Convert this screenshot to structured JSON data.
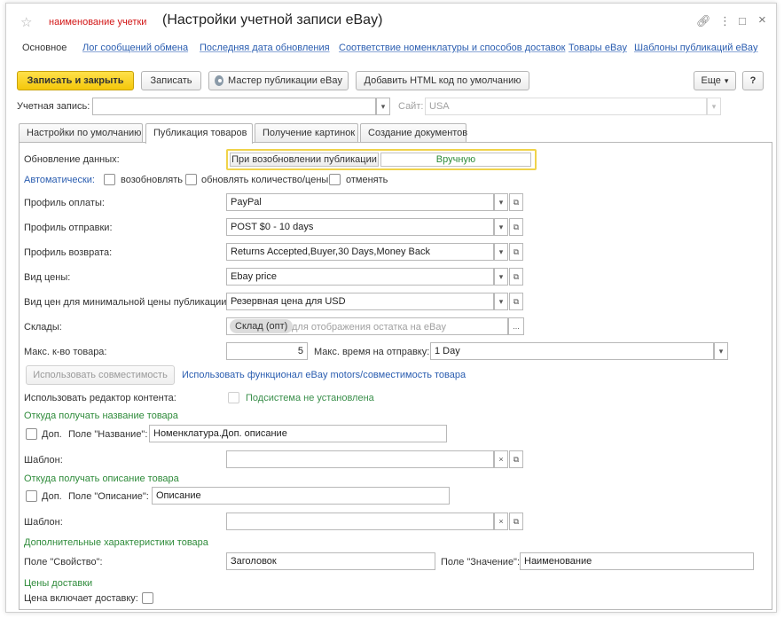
{
  "window": {
    "star_icon": "☆",
    "title_prefix": "наименование учетки",
    "title": "(Настройки учетной записи eBay)",
    "link_icon": "🔗",
    "menu_icon": "⋮",
    "maximize_icon": "□",
    "close_icon": "×"
  },
  "nav": {
    "items": [
      {
        "label": "Основное"
      },
      {
        "label": "Лог сообщений обмена"
      },
      {
        "label": "Последняя дата обновления"
      },
      {
        "label": "Соответствие номенклатуры и способов доставок"
      },
      {
        "label": "Товары eBay"
      },
      {
        "label": "Шаблоны публикаций eBay"
      }
    ]
  },
  "toolbar": {
    "save_close": "Записать и закрыть",
    "save": "Записать",
    "wizard": "Мастер публикации eBay",
    "add_html": "Добавить HTML код по умолчанию",
    "more": "Еще",
    "more_arrow": "▾",
    "help": "?"
  },
  "account": {
    "label": "Учетная запись:",
    "value": "",
    "site_label": "Сайт:",
    "site_value": "USA",
    "arrow": "▾"
  },
  "tabs": [
    {
      "label": "Настройки по умолчанию"
    },
    {
      "label": "Публикация товаров"
    },
    {
      "label": "Получение картинок"
    },
    {
      "label": "Создание документов"
    }
  ],
  "form": {
    "update_label": "Обновление данных:",
    "update_opt1": "При возобновлении публикации",
    "update_opt2": "Вручную",
    "auto_label": "Автоматически:",
    "auto_opt1": "возобновлять",
    "auto_opt2": "обновлять количество/цены",
    "auto_opt3": "отменять",
    "payment_label": "Профиль оплаты:",
    "payment_value": "PayPal",
    "shipping_label": "Профиль отправки:",
    "shipping_value": "POST $0 - 10 days",
    "return_label": "Профиль возврата:",
    "return_value": "Returns Accepted,Buyer,30 Days,Money Back",
    "price_type_label": "Вид цены:",
    "price_type_value": "Ebay price",
    "min_price_label": "Вид цен для минимальной цены публикации:",
    "min_price_value": "Резервная цена для USD",
    "warehouses_label": "Склады:",
    "warehouse_chip": "Склад (опт)",
    "warehouse_hint": "для отображения остатка на eBay",
    "ellipsis": "...",
    "max_qty_label": "Макс. к-во товара:",
    "max_qty_value": "5",
    "max_ship_label": "Макс. время на отправку:",
    "max_ship_value": "1 Day",
    "compat_button": "Использовать совместимость",
    "compat_link": "Использовать функционал eBay motors/совместимость товара",
    "editor_label": "Использовать редактор контента:",
    "editor_value": "Подсистема не установлена",
    "name_section": "Откуда получать название товара",
    "name_dop": "Доп.",
    "name_field_label": "Поле \"Название\":",
    "name_field_value": "Номенклатура.Доп. описание",
    "template_label": "Шаблон:",
    "desc_section": "Откуда получать описание товара",
    "desc_dop": "Доп.",
    "desc_field_label": "Поле \"Описание\":",
    "desc_field_value": "Описание",
    "template2_label": "Шаблон:",
    "extra_section": "Дополнительные характеристики товара",
    "prop_label": "Поле \"Свойство\":",
    "prop_value": "Заголовок",
    "value_label": "Поле \"Значение\":",
    "value_value": "Наименование",
    "delivery_section": "Цены доставки",
    "delivery_label": "Цена включает доставку:",
    "dropdown_arrow": "▾",
    "open_icon": "⧉",
    "clear_icon": "×"
  }
}
